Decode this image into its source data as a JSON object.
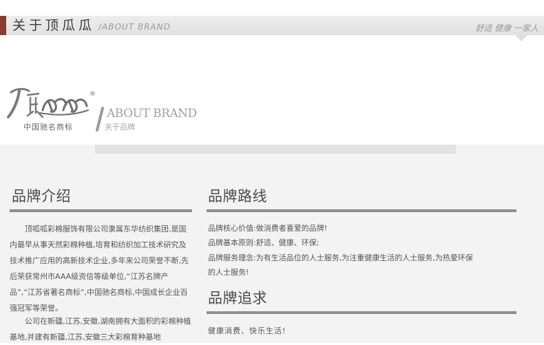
{
  "header": {
    "title": "关于顶瓜瓜",
    "subtitle": "/ABOUT BRAND",
    "slogan": "舒适 健康 一家人"
  },
  "logo": {
    "registered_mark": "®",
    "caption": "中国驰名商标"
  },
  "about_block": {
    "title_en": "ABOUT BRAND",
    "title_cn": "关于品牌"
  },
  "brand_intro": {
    "title": "品牌介绍",
    "paragraphs": [
      "顶呱呱彩棉服饰有限公司隶属东华纺织集团,是国内最早从事天然彩棉种植,培育和纺织加工技术研究及技术推广应用的高新技术企业,多年来公司荣誉不断,先后荣获常州市AAA级资信等级单位,“江苏名牌产品”,“江苏省著名商标”,中国驰名商标,中国成长企业百强冠军等荣誉。",
      "公司在新疆,江苏,安徽,湖南拥有大面积的彩棉种植基地,并建有新疆,江苏,安徽三大彩棉育种基地"
    ]
  },
  "brand_route": {
    "title": "品牌路线",
    "lines": [
      "品牌核心价值:做消费者喜爱的品牌!",
      "品牌基本原则:舒适、健康、环保;",
      "品牌服务理念:为有生活品位的人士服务,为注重健康生活的人士服务,为热爱环保",
      "的人士服务!"
    ]
  },
  "brand_pursuit": {
    "title": "品牌追求",
    "text": "健康消费、快乐生活!"
  },
  "colors": {
    "accent": "#8c3a34",
    "rule": "#8d8d8d",
    "content_bg": "#f3f3f3"
  }
}
